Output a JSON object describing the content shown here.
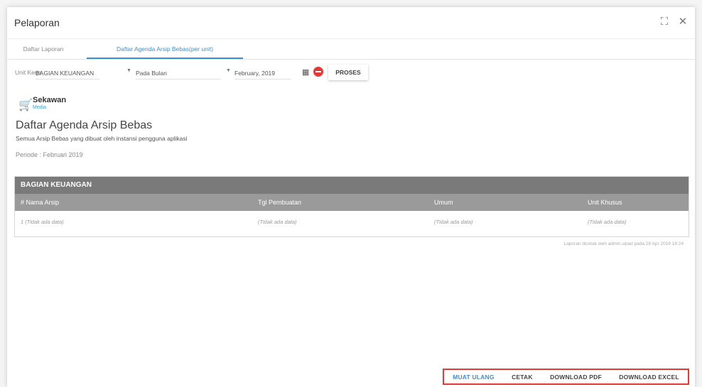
{
  "window": {
    "title": "Pelaporan"
  },
  "tabs": [
    {
      "label": "Daftar Laporan",
      "active": false
    },
    {
      "label": "Daftar Agenda Arsip Bebas(per unit)",
      "active": true
    }
  ],
  "filter": {
    "unit_label": "Unit Kerja",
    "unit_value": "BAGIAN KEUANGAN",
    "pada_value": "Pada Bulan",
    "month_value": "February, 2019",
    "proses_label": "PROSES"
  },
  "logo": {
    "name": "Sekawan",
    "sub": "Media"
  },
  "report": {
    "heading": "Daftar Agenda Arsip Bebas",
    "subtitle": "Semua Arsip Bebas yang dibuat oleh instansi pengguna aplikasi",
    "periode": "Periode : Februari 2019",
    "group": "BAGIAN KEUANGAN",
    "columns": [
      "# Nama Arsip",
      "Tgl Pembuatan",
      "Umum",
      "Unit Khusus"
    ],
    "row": [
      "1  (Tidak ada data)",
      "(Tidak ada data)",
      "(Tidak ada data)",
      "(Tidak ada data)"
    ],
    "footnote": "Laporan dicetak oleh admin.sipad pada 28 Apr 2019 18:24"
  },
  "actions": {
    "reload": "MUAT ULANG",
    "print": "CETAK",
    "pdf": "DOWNLOAD PDF",
    "excel": "DOWNLOAD EXCEL"
  },
  "colors": {
    "accent": "#3a8fd6",
    "danger": "#e53935",
    "group_head": "#7a7a7a",
    "col_head": "#9a9a9a"
  }
}
